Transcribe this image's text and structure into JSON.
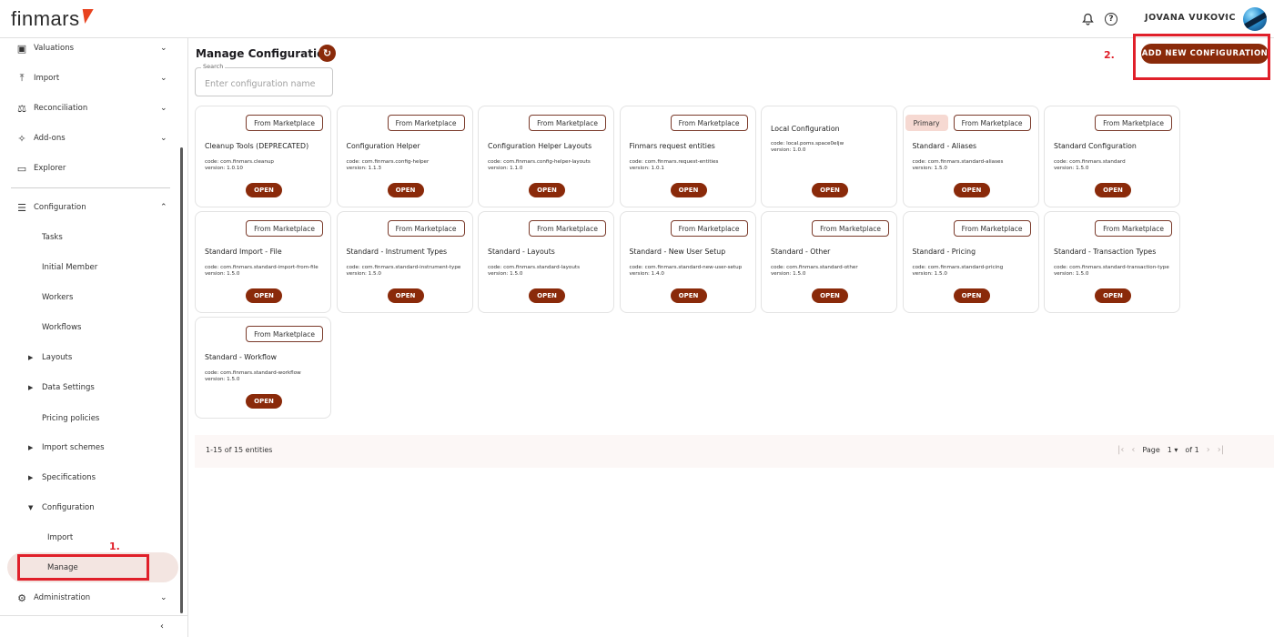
{
  "header": {
    "logo_text": "finmars",
    "bell_icon": "bell-icon",
    "help_icon": "help-circle-icon",
    "user_name": "JOVANA VUKOVIC",
    "user_chevron": "⌄"
  },
  "sidebar": {
    "items": [
      {
        "label": "Valuations",
        "icon": "valuations-icon"
      },
      {
        "label": "Import",
        "icon": "import-icon"
      },
      {
        "label": "Reconciliation",
        "icon": "scales-icon"
      },
      {
        "label": "Add-ons",
        "icon": "puzzle-icon"
      },
      {
        "label": "Explorer",
        "icon": "folder-icon"
      },
      {
        "label": "Configuration",
        "icon": "sliders-icon"
      },
      {
        "label": "Administration",
        "icon": "admin-gear-icon"
      }
    ],
    "config_children": [
      "Tasks",
      "Initial Member",
      "Workers",
      "Workflows"
    ],
    "config_expandable": [
      "Layouts",
      "Data Settings"
    ],
    "pricing_policies": "Pricing policies",
    "more_expandable": [
      "Import schemes",
      "Specifications"
    ],
    "nested_configuration": "Configuration",
    "nested_children": [
      "Import",
      "Manage"
    ]
  },
  "annotations": {
    "label_1": "1.",
    "label_2": "2."
  },
  "main": {
    "title": "Manage Configuration",
    "search": {
      "legend": "Search",
      "placeholder": "Enter configuration name"
    },
    "add_button": "ADD NEW CONFIGURATION",
    "open_label": "OPEN",
    "primary_badge": "Primary",
    "marketplace_badge": "From Marketplace",
    "cards": [
      {
        "name": "Cleanup Tools (DEPRECATED)",
        "code": "code: com.finmars.cleanup",
        "version": "version: 1.0.10"
      },
      {
        "name": "Configuration Helper",
        "code": "code: com.finmars.config-helper",
        "version": "version: 1.1.3"
      },
      {
        "name": "Configuration Helper Layouts",
        "code": "code: com.finmars.config-helper-layouts",
        "version": "version: 1.1.0"
      },
      {
        "name": "Finmars request entities",
        "code": "code: com.finmars.request-entities",
        "version": "version: 1.0.1"
      },
      {
        "name": "Local Configuration",
        "code": "code: local.poms.space0eljw",
        "version": "version: 1.0.0"
      },
      {
        "name": "Standard - Aliases",
        "code": "code: com.finmars.standard-aliases",
        "version": "version: 1.5.0"
      },
      {
        "name": "Standard Configuration",
        "code": "code: com.finmars.standard",
        "version": "version: 1.5.0"
      },
      {
        "name": "Standard Import - File",
        "code": "code: com.finmars.standard-import-from-file",
        "version": "version: 1.5.0"
      },
      {
        "name": "Standard - Instrument Types",
        "code": "code: com.finmars.standard-instrument-type",
        "version": "version: 1.5.0"
      },
      {
        "name": "Standard - Layouts",
        "code": "code: com.finmars.standard-layouts",
        "version": "version: 1.5.0"
      },
      {
        "name": "Standard - New User Setup",
        "code": "code: com.finmars.standard-new-user-setup",
        "version": "version: 1.4.0"
      },
      {
        "name": "Standard - Other",
        "code": "code: com.finmars.standard-other",
        "version": "version: 1.5.0"
      },
      {
        "name": "Standard - Pricing",
        "code": "code: com.finmars.standard-pricing",
        "version": "version: 1.5.0"
      },
      {
        "name": "Standard - Transaction Types",
        "code": "code: com.finmars.standard-transaction-type",
        "version": "version: 1.5.0"
      },
      {
        "name": "Standard - Workflow",
        "code": "code: com.finmars.standard-workflow",
        "version": "version: 1.5.0"
      }
    ],
    "footer": {
      "count": "1-15 of 15 entities",
      "page_label": "Page",
      "page_value": "1",
      "of_label": "of 1"
    }
  },
  "colors": {
    "brand": "#8a2a0a",
    "annotation": "#e0202a",
    "active_bg": "#f3e5e1",
    "logo_accent": "#e8431f"
  }
}
